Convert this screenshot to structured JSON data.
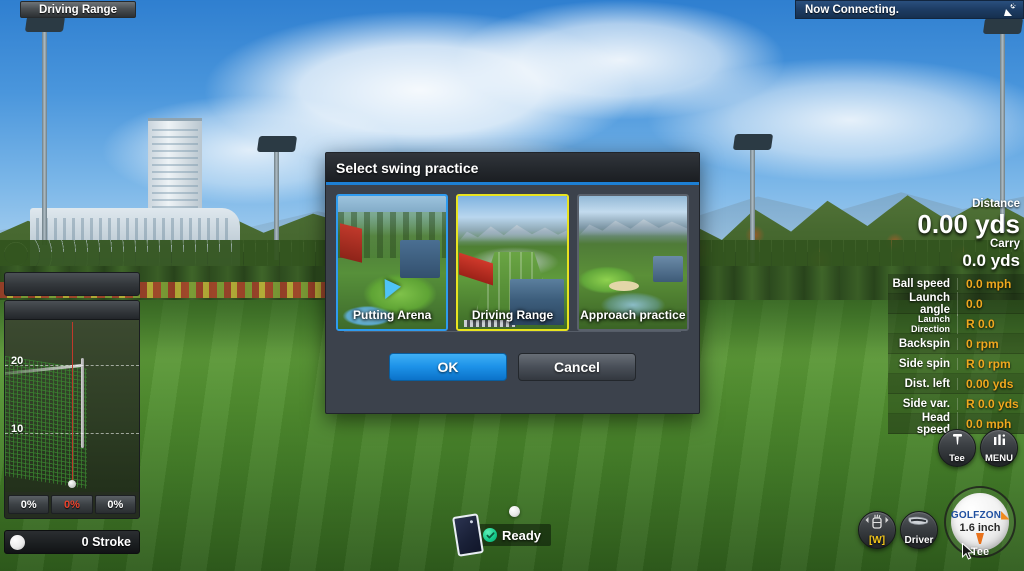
{
  "topbar": {
    "course_label": "Driving Range",
    "connection_status": "Now Connecting.",
    "signal_icon": "satellite-dish-icon"
  },
  "trajectory_panel": {
    "grid_labels": [
      "20",
      "10"
    ],
    "percent_cells": [
      "0%",
      "0%",
      "0%"
    ],
    "stroke_label": "0 Stroke"
  },
  "stats": {
    "distance_label": "Distance",
    "distance_value": "0.00 yds",
    "carry_label": "Carry",
    "carry_value": "0.0 yds",
    "rows": [
      {
        "label": "Ball speed",
        "value": "0.0 mph",
        "small": false
      },
      {
        "label": "Launch angle",
        "value": "0.0",
        "small": false
      },
      {
        "label": "Launch Direction",
        "value": "R 0.0",
        "small": true
      },
      {
        "label": "Backspin",
        "value": "0 rpm",
        "small": false
      },
      {
        "label": "Side spin",
        "value": "R 0 rpm",
        "small": false
      },
      {
        "label": "Dist. left",
        "value": "0.00 yds",
        "small": false
      },
      {
        "label": "Side var.",
        "value": "R 0.0 yds",
        "small": false
      },
      {
        "label": "Head speed",
        "value": "0.0 mph",
        "small": false
      }
    ]
  },
  "controls": {
    "tee_button": "Tee",
    "menu_button": "MENU",
    "club_selector": "[W]",
    "club_name": "Driver",
    "ball_logo": "GOLFZON",
    "tee_height": "1.6 inch",
    "tee_caption": "Tee"
  },
  "status": {
    "ready_text": "Ready",
    "device_icon": "phone-icon",
    "check_icon": "check-circle-icon"
  },
  "dialog": {
    "title": "Select swing practice",
    "options": [
      {
        "label": "Putting Arena",
        "state": "highlighted"
      },
      {
        "label": "Driving Range",
        "state": "selected"
      },
      {
        "label": "Approach practice",
        "state": "normal"
      }
    ],
    "ok_label": "OK",
    "cancel_label": "Cancel"
  },
  "colors": {
    "accent_blue": "#1d7fd4",
    "selected_yellow": "#e8e320",
    "stat_value_orange": "#f0a81e",
    "alert_red": "#e8412c"
  }
}
